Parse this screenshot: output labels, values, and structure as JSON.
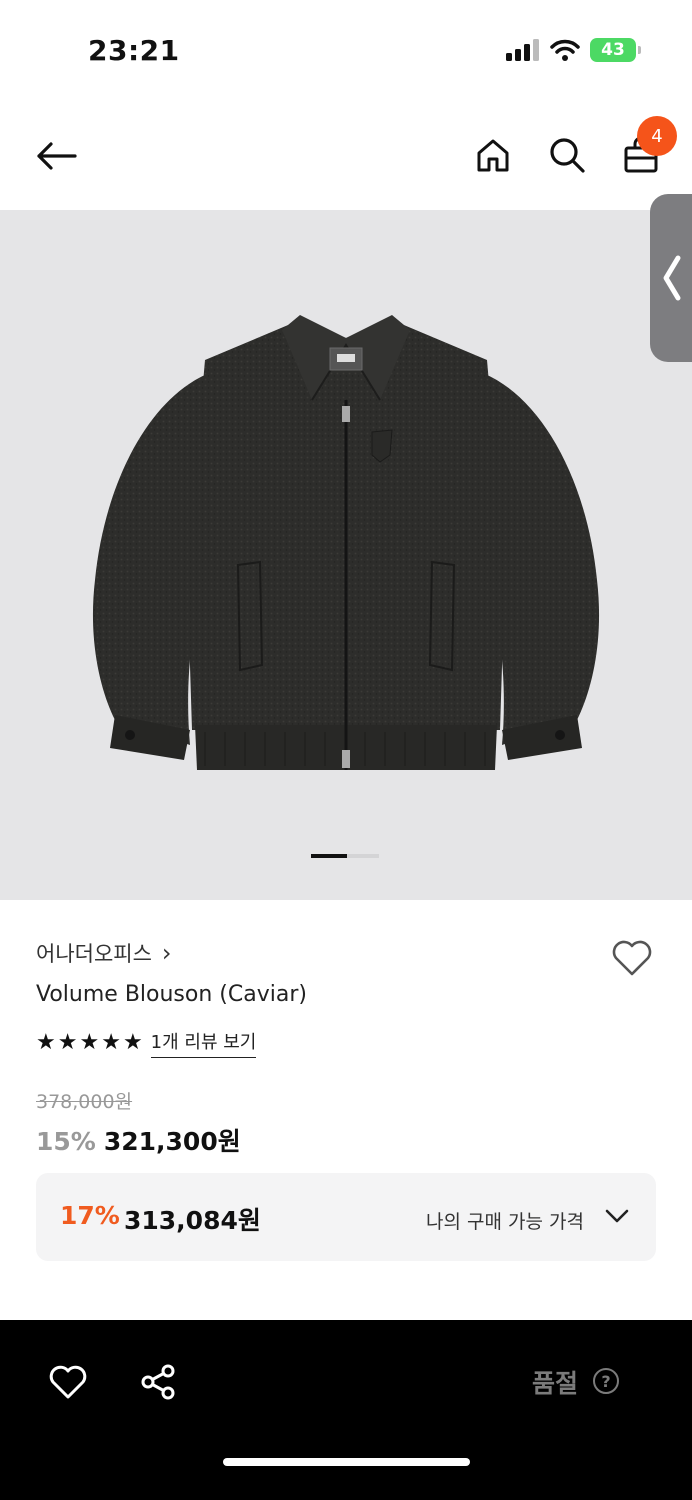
{
  "status_bar": {
    "time": "23:21",
    "battery": "43",
    "icons": [
      "cellular-signal-icon",
      "wifi-icon",
      "battery-charging-icon"
    ]
  },
  "nav": {
    "icons": [
      "back-arrow-icon",
      "home-icon",
      "search-icon",
      "shopping-bag-icon"
    ],
    "cart_count": "4"
  },
  "gallery": {
    "image_subject": "dark charcoal wool zip-up blouson jacket",
    "side_tab_icon": "chevron-left-icon"
  },
  "product": {
    "brand": "어나더오피스",
    "brand_chevron": "›",
    "name": "Volume Blouson (Caviar)",
    "rating_stars": 5,
    "review_link": "1개 리뷰 보기",
    "original_price": "378,000원",
    "discount": "15%",
    "price": "321,300원"
  },
  "my_price": {
    "discount": "17%",
    "price": "313,084원",
    "label": "나의 구매 가능 가격"
  },
  "bottom_bar": {
    "status": "품절",
    "help": "?",
    "icons": [
      "heart-icon",
      "share-icon",
      "help-circle-icon"
    ]
  },
  "colors": {
    "accent": "#f05b1f",
    "badge": "#f5541a",
    "hero_bg": "#e5e5e7",
    "bottom_bar": "#000000"
  }
}
